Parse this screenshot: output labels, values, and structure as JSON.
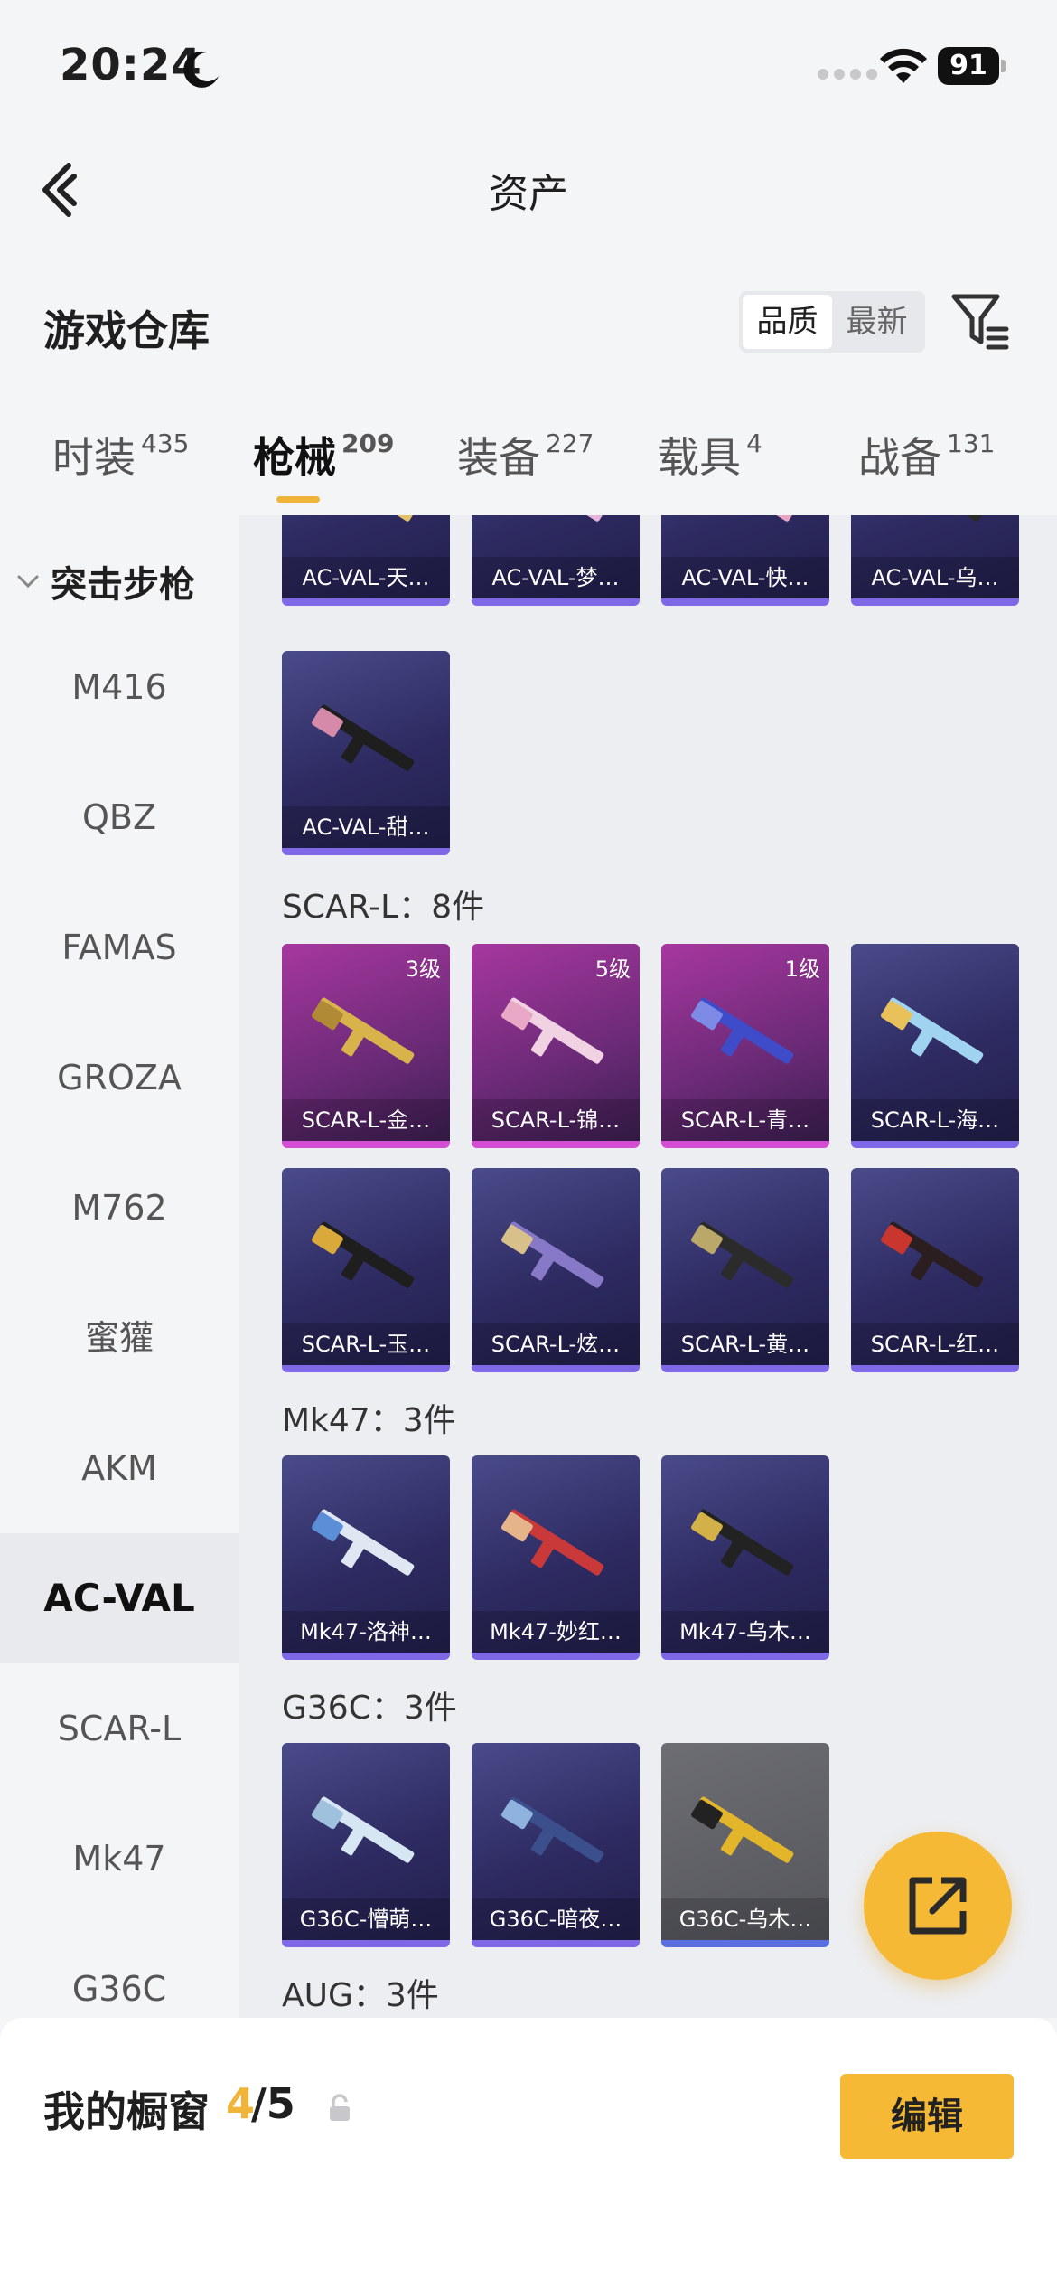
{
  "status_bar": {
    "time": "20:24",
    "battery": "91"
  },
  "nav": {
    "title": "资产"
  },
  "header": {
    "title": "游戏仓库",
    "sort_quality": "品质",
    "sort_newest": "最新"
  },
  "tabs": [
    {
      "label": "时装",
      "count": "435"
    },
    {
      "label": "枪械",
      "count": "209"
    },
    {
      "label": "装备",
      "count": "227"
    },
    {
      "label": "载具",
      "count": "4"
    },
    {
      "label": "战备",
      "count": "131"
    }
  ],
  "sidebar": {
    "group": "突击步枪",
    "items": [
      "M416",
      "QBZ",
      "FAMAS",
      "GROZA",
      "M762",
      "蜜獾",
      "AKM",
      "AC-VAL",
      "SCAR-L",
      "Mk47",
      "G36C"
    ],
    "active": "AC-VAL"
  },
  "groups": {
    "acval": {
      "cards": [
        {
          "name": "AC-VAL-天…",
          "level": ""
        },
        {
          "name": "AC-VAL-梦…",
          "level": ""
        },
        {
          "name": "AC-VAL-快…",
          "level": ""
        },
        {
          "name": "AC-VAL-乌…",
          "level": ""
        },
        {
          "name": "AC-VAL-甜…",
          "level": ""
        }
      ]
    },
    "scarl": {
      "label": "SCAR-L：8件",
      "cards": [
        {
          "name": "SCAR-L-金…",
          "level": "3级"
        },
        {
          "name": "SCAR-L-锦…",
          "level": "5级"
        },
        {
          "name": "SCAR-L-青…",
          "level": "1级"
        },
        {
          "name": "SCAR-L-海…",
          "level": ""
        },
        {
          "name": "SCAR-L-玉…",
          "level": ""
        },
        {
          "name": "SCAR-L-炫…",
          "level": ""
        },
        {
          "name": "SCAR-L-黄…",
          "level": ""
        },
        {
          "name": "SCAR-L-红…",
          "level": ""
        }
      ]
    },
    "mk47": {
      "label": "Mk47：3件",
      "cards": [
        {
          "name": "Mk47-洛神…",
          "level": ""
        },
        {
          "name": "Mk47-妙红…",
          "level": ""
        },
        {
          "name": "Mk47-乌木…",
          "level": ""
        }
      ]
    },
    "g36c": {
      "label": "G36C：3件",
      "cards": [
        {
          "name": "G36C-懵萌…",
          "level": ""
        },
        {
          "name": "G36C-暗夜…",
          "level": ""
        },
        {
          "name": "G36C-乌木…",
          "level": ""
        }
      ]
    },
    "aug": {
      "label": "AUG：3件"
    }
  },
  "showcase": {
    "label": "我的橱窗",
    "count": "4",
    "total": "/5",
    "edit_label": "编辑"
  },
  "colors": {
    "accent": "#f6b936",
    "purple_card": "#2e2b62",
    "pink_card": "#a7379f"
  }
}
